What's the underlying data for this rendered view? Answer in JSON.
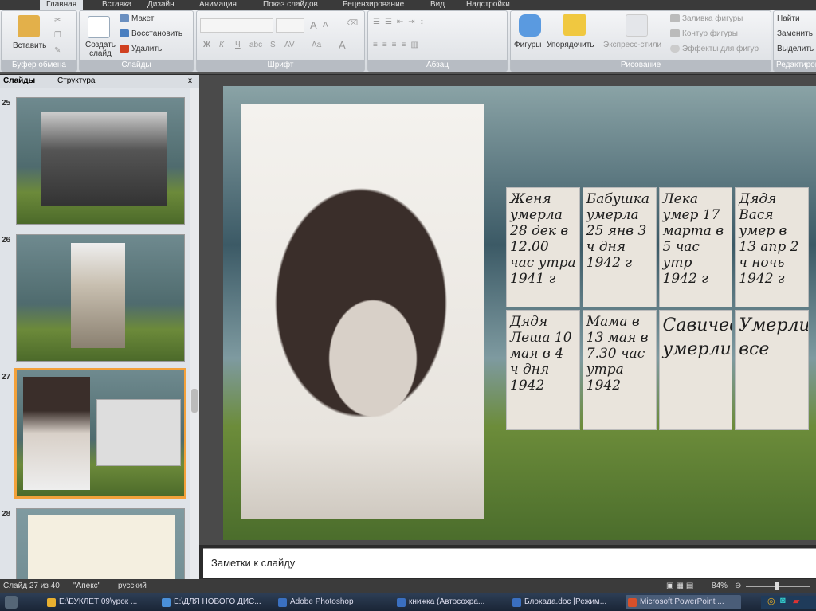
{
  "ribbon_tabs": [
    "Главная",
    "Вставка",
    "Дизайн",
    "Анимация",
    "Показ слайдов",
    "Рецензирование",
    "Вид",
    "Надстройки"
  ],
  "clipboard": {
    "paste": "Вставить",
    "group": "Буфер обмена"
  },
  "slides_group": {
    "new_slide": "Создать слайд",
    "layout": "Макет",
    "reset": "Восстановить",
    "delete": "Удалить",
    "group": "Слайды"
  },
  "font_group": {
    "bold": "Ж",
    "italic": "К",
    "underline": "Ч",
    "strike": "abc",
    "shadow": "S",
    "spacing": "AV",
    "case": "Aa",
    "grow": "A",
    "shrink": "A",
    "color": "A",
    "group": "Шрифт"
  },
  "paragraph_group": {
    "group": "Абзац"
  },
  "drawing_group": {
    "shapes": "Фигуры",
    "arrange": "Упорядочить",
    "quick_styles": "Экспресс-стили",
    "fill": "Заливка фигуры",
    "outline": "Контур фигуры",
    "effects": "Эффекты для фигур",
    "group": "Рисование"
  },
  "editing_group": {
    "find": "Найти",
    "replace": "Заменить",
    "select": "Выделить",
    "group": "Редактирование"
  },
  "panel": {
    "tab_slides": "Слайды",
    "tab_outline": "Структура",
    "close": "x"
  },
  "thumbnails": [
    {
      "num": "25"
    },
    {
      "num": "26"
    },
    {
      "num": "27",
      "selected": true
    },
    {
      "num": "28"
    }
  ],
  "slide_cards": [
    "Женя умерла 28 дек в 12.00 час утра 1941 г",
    "Бабушка умерла 25 янв 3 ч дня 1942 г",
    "Лека умер 17 марта в 5 час утр 1942 г",
    "Дядя Вася умер в 13 апр 2 ч ночь 1942 г",
    "Дядя Леша 10 мая в 4 ч дня 1942",
    "Мама в 13 мая в 7.30 час утра 1942",
    "Савичевы умерли",
    "Умерли все"
  ],
  "notes_placeholder": "Заметки к слайду",
  "status": {
    "slide": "Слайд 27 из 40",
    "theme": "\"Апекс\"",
    "lang": "русский",
    "zoom": "84%"
  },
  "taskbar": [
    {
      "label": "E:\\БУКЛЕТ 09\\урок ...",
      "color": "#e8b030"
    },
    {
      "label": "E:\\ДЛЯ НОВОГО ДИС...",
      "color": "#4a8fd8"
    },
    {
      "label": "Adobe Photoshop",
      "color": "#3a70c0"
    },
    {
      "label": "книжка (Автосохра...",
      "color": "#3a6fc0"
    },
    {
      "label": "Блокада.doc [Режим...",
      "color": "#3a6fc0"
    },
    {
      "label": "Microsoft PowerPoint ...",
      "color": "#d8502a",
      "active": true
    }
  ]
}
